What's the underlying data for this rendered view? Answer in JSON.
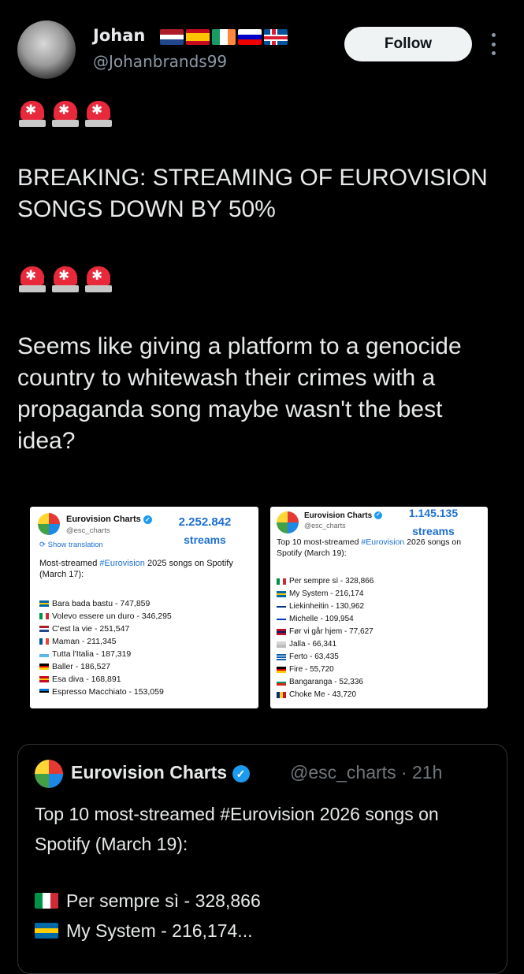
{
  "author": {
    "name": "Johan",
    "handle": "@Johanbrands99",
    "flags": [
      "nl",
      "es",
      "ie",
      "si",
      "is"
    ]
  },
  "follow_label": "Follow",
  "tweet": {
    "headline": "BREAKING: STREAMING OF EUROVISION SONGS DOWN BY 50%",
    "body": "Seems like giving a platform to a genocide country to whitewash their crimes with a propaganda song maybe wasn't the best idea?"
  },
  "image_left": {
    "name": "Eurovision Charts",
    "handle": "@esc_charts",
    "show_translation": "Show translation",
    "streams_value": "2.252.842",
    "streams_label": "streams",
    "caption_pre": "Most-streamed ",
    "caption_hash": "#Eurovision",
    "caption_post": " 2025 songs on Spotify (March 17):",
    "items": [
      {
        "flag": "se",
        "text": "Bara bada bastu - 747,859"
      },
      {
        "flag": "it",
        "text": "Volevo essere un duro - 346,295"
      },
      {
        "flag": "nl",
        "text": "C'est la vie - 251,547"
      },
      {
        "flag": "fr",
        "text": "Maman - 211,345"
      },
      {
        "flag": "sm",
        "text": "Tutta l'Italia - 187,319"
      },
      {
        "flag": "de",
        "text": "Baller - 186,527"
      },
      {
        "flag": "es",
        "text": "Esa diva - 168,891"
      },
      {
        "flag": "ee",
        "text": "Espresso Macchiato - 153,059"
      }
    ]
  },
  "image_right": {
    "name": "Eurovision Charts",
    "handle": "@esc_charts",
    "streams_value": "1.145.135",
    "streams_label": "streams",
    "caption_pre": "Top 10 most-streamed ",
    "caption_hash": "#Eurovision",
    "caption_post": " 2026 songs on Spotify (March 19):",
    "items": [
      {
        "flag": "it",
        "text": "Per sempre sì - 328,866"
      },
      {
        "flag": "se",
        "text": "My System - 216,174"
      },
      {
        "flag": "fi",
        "text": "Liekinheitin - 130,962"
      },
      {
        "flag": "il",
        "text": "Michelle - 109,954"
      },
      {
        "flag": "no",
        "text": "Før vi går hjem - 77,627"
      },
      {
        "flag": "ma",
        "text": "Jalla - 66,341"
      },
      {
        "flag": "gr",
        "text": "Ferto - 63,435"
      },
      {
        "flag": "de",
        "text": "Fire - 55,720"
      },
      {
        "flag": "bg",
        "text": "Bangaranga - 52,336"
      },
      {
        "flag": "ro",
        "text": "Choke Me - 43,720"
      }
    ]
  },
  "quote": {
    "name": "Eurovision Charts",
    "handle_time": "@esc_charts · 21h",
    "text": "Top 10 most-streamed #Eurovision 2026 songs on Spotify (March 19):",
    "items": [
      {
        "flag": "it",
        "text": "Per sempre sì - 328,866"
      },
      {
        "flag": "se",
        "text": "My System - 216,174..."
      }
    ]
  }
}
